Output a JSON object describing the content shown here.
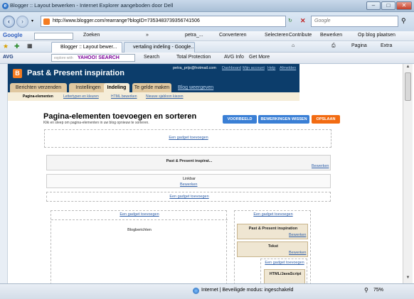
{
  "window": {
    "title": "Blogger :: Layout bewerken - Internet Explorer aangeboden door Dell",
    "controls": [
      "–",
      "□",
      "✕"
    ]
  },
  "address": {
    "url": "http://www.blogger.com/rearrange?blogID=7353483739356741506",
    "search_placeholder": "Google"
  },
  "google_toolbar": {
    "logo": "Google",
    "search_label": "Zoeken",
    "items": [
      "petra_...",
      "Converteren",
      "Selecteren",
      "Contribute",
      "Bewerken",
      "Op blog plaatsen"
    ]
  },
  "ie_tabs": {
    "tabs": [
      {
        "label": "Blogger :: Layout bewer..."
      },
      {
        "label": "vertaling indeling - Google..."
      }
    ],
    "right_items": [
      "Pagina",
      "Extra"
    ]
  },
  "avg_bar": {
    "logo": "AVG",
    "search_hint": "explore with",
    "yahoo": "YAHOO! SEARCH",
    "search_button": "Search",
    "items": [
      "Total Protection",
      "AVG Info",
      "Get More"
    ]
  },
  "blogger": {
    "blog_title": "Past & Present inspiration",
    "user_email": "petra_prijs@hotmail.com",
    "user_links": [
      "Dashboard",
      "Mijn account",
      "Help",
      "Afmelden"
    ],
    "tabs": [
      {
        "label": "Berichten verzenden",
        "active": false
      },
      {
        "label": "Instellingen",
        "active": false
      },
      {
        "label": "Indeling",
        "active": true
      },
      {
        "label": "Te gelde maken",
        "active": false
      }
    ],
    "view_blog": "Blog weergeven",
    "subnav": [
      {
        "label": "Pagina-elementen",
        "selected": true
      },
      {
        "label": "Lettertypen en kleuren",
        "selected": false
      },
      {
        "label": "HTML bewerken",
        "selected": false
      },
      {
        "label": "Nieuwe sjabloon kiezen",
        "selected": false
      }
    ],
    "heading": "Pagina-elementen toevoegen en sorteren",
    "hint": "Klik en sleep om pagina-elementen in uw blog opnieuw te sorteren.",
    "buttons": {
      "preview": "VOORBEELD",
      "clear": "BEWERKINGEN WISSEN",
      "save": "OPSLAAN"
    },
    "add_gadget": "Een gadget toevoegen",
    "edit": "Bewerken",
    "gadgets": {
      "header": "Past & Present inspirat...",
      "linkbar": "Linkbar",
      "blogposts": "Blogberichten",
      "sidebar_title": "Past & Present inspiration",
      "text": "Tekst",
      "html": "HTML/JavaScript"
    }
  },
  "status": {
    "text": "Internet | Beveiligde modus: ingeschakeld",
    "zoom": "75%"
  },
  "colors": {
    "blogger_navy": "#0c3d6b",
    "blogger_orange": "#f47b20",
    "preview_blue": "#3a7fd5",
    "save_orange": "#f26b12"
  }
}
